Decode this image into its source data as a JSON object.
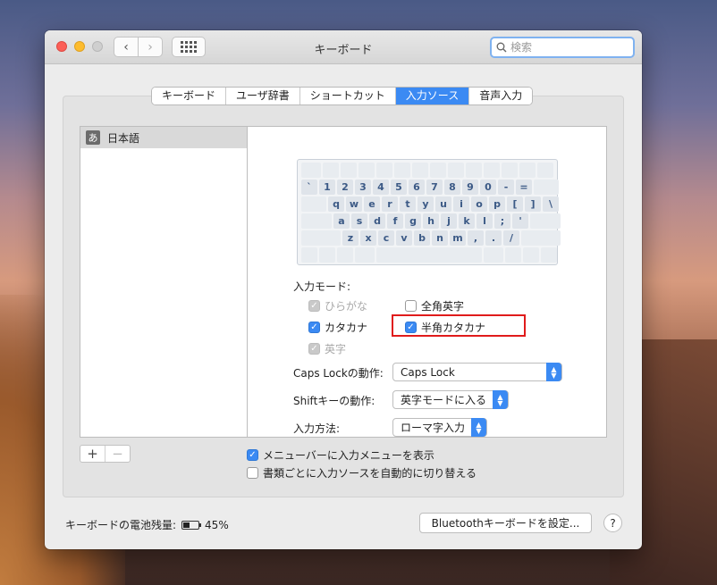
{
  "window": {
    "title": "キーボード"
  },
  "search": {
    "placeholder": "検索"
  },
  "tabs": [
    {
      "label": "キーボード"
    },
    {
      "label": "ユーザ辞書"
    },
    {
      "label": "ショートカット"
    },
    {
      "label": "入力ソース",
      "active": true
    },
    {
      "label": "音声入力"
    }
  ],
  "sources": [
    {
      "badge": "あ",
      "label": "日本語"
    }
  ],
  "keyboard": {
    "row1": [
      "`",
      "1",
      "2",
      "3",
      "4",
      "5",
      "6",
      "7",
      "8",
      "9",
      "0",
      "-",
      "="
    ],
    "row2": [
      "q",
      "w",
      "e",
      "r",
      "t",
      "y",
      "u",
      "i",
      "o",
      "p",
      "[",
      "]",
      "\\"
    ],
    "row3": [
      "a",
      "s",
      "d",
      "f",
      "g",
      "h",
      "j",
      "k",
      "l",
      ";",
      "'"
    ],
    "row4": [
      "z",
      "x",
      "c",
      "v",
      "b",
      "n",
      "m",
      ",",
      ".",
      "/"
    ]
  },
  "input_mode": {
    "label": "入力モード:",
    "hiragana": "ひらがな",
    "fullwidth_roman": "全角英字",
    "katakana": "カタカナ",
    "halfwidth_katakana": "半角カタカナ",
    "roman": "英字"
  },
  "caps_lock": {
    "label": "Caps Lockの動作:",
    "value": "Caps Lock"
  },
  "shift": {
    "label": "Shiftキーの動作:",
    "value": "英字モードに入る"
  },
  "input_method": {
    "label": "入力方法:",
    "value": "ローマ字入力"
  },
  "options": {
    "show_menu": "メニューバーに入力メニューを表示",
    "auto_switch": "書類ごとに入力ソースを自動的に切り替える"
  },
  "footer": {
    "battery_label": "キーボードの電池残量:",
    "battery_level": "45%",
    "bluetooth_button": "Bluetoothキーボードを設定...",
    "help": "?"
  },
  "colors": {
    "accent": "#3b8af3",
    "highlight": "#e01b1b"
  }
}
